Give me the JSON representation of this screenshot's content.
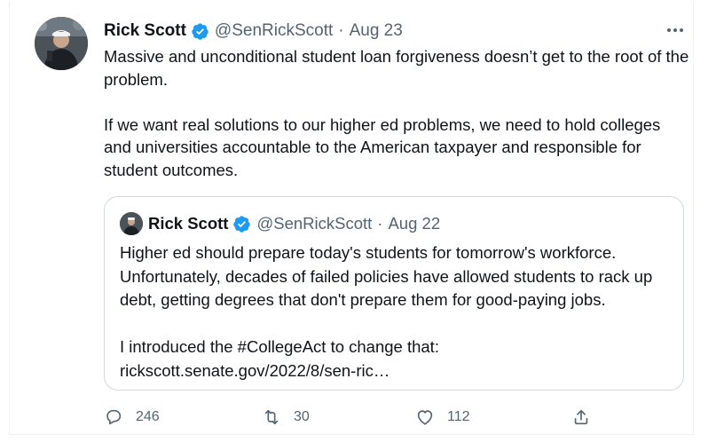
{
  "tweet": {
    "author_name": "Rick Scott",
    "handle": "@SenRickScott",
    "separator": "·",
    "date": "Aug 23",
    "more_icon": "more-horizontal-icon",
    "paragraphs": [
      "Massive and unconditional student loan forgiveness doesn’t get to the root of the problem.",
      "If we want real solutions to our higher ed problems, we need to hold colleges and universities accountable to the American taxpayer and responsible for student outcomes."
    ]
  },
  "quoted_tweet": {
    "author_name": "Rick Scott",
    "handle": "@SenRickScott",
    "separator": "·",
    "date": "Aug 22",
    "paragraphs": [
      "Higher ed should prepare today's students for tomorrow's workforce. Unfortunately, decades of failed policies have allowed students to rack up debt, getting degrees that don't prepare them for good-paying jobs.",
      "I introduced the #CollegeAct to change that: rickscott.senate.gov/2022/8/sen-ric…"
    ]
  },
  "actions": {
    "replies": "246",
    "retweets": "30",
    "likes": "112"
  },
  "colors": {
    "verified": "#1d9bf0",
    "muted": "#536471",
    "border": "#cfd9de"
  }
}
